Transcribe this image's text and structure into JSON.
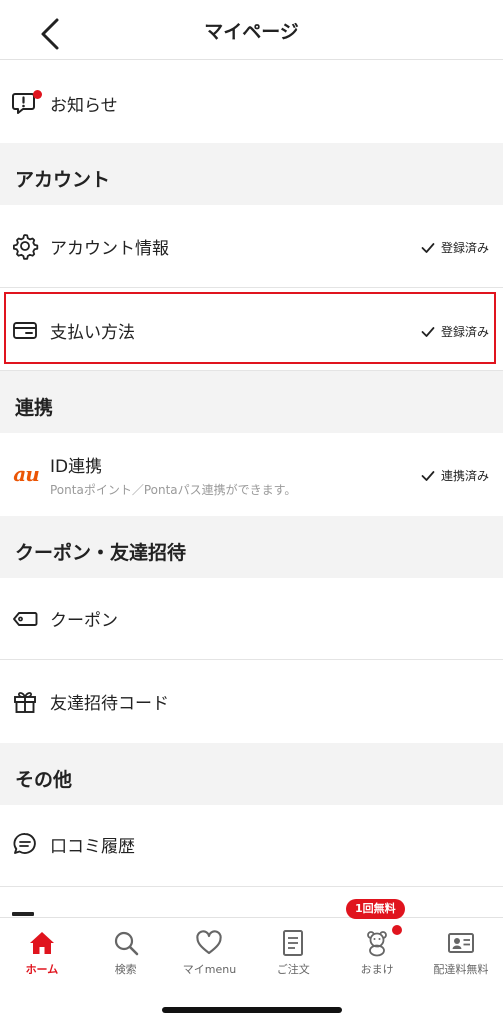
{
  "header": {
    "title": "マイページ"
  },
  "notice": {
    "label": "お知らせ"
  },
  "sections": {
    "account": "アカウント",
    "link": "連携",
    "coupon": "クーポン・友達招待",
    "other": "その他"
  },
  "account_info": {
    "label": "アカウント情報",
    "status": "登録済み"
  },
  "payment": {
    "label": "支払い方法",
    "status": "登録済み"
  },
  "id_link": {
    "logo": "au",
    "label": "ID連携",
    "sub": "Pontaポイント／Pontaパス連携ができます。",
    "status": "連携済み"
  },
  "coupon": {
    "label": "クーポン"
  },
  "invite": {
    "label": "友達招待コード"
  },
  "reviews": {
    "label": "口コミ履歴"
  },
  "tabbar": {
    "badge": "1回無料",
    "tabs": [
      {
        "label": "ホーム",
        "icon": "home-icon"
      },
      {
        "label": "検索",
        "icon": "search-icon"
      },
      {
        "label": "マイmenu",
        "icon": "heart-icon"
      },
      {
        "label": "ご注文",
        "icon": "order-icon"
      },
      {
        "label": "おまけ",
        "icon": "bear-icon"
      },
      {
        "label": "配達料無料",
        "icon": "member-card-icon"
      }
    ]
  },
  "colors": {
    "accent": "#e0141e",
    "section_bg": "#f3f3f3",
    "au_orange": "#eb5505"
  }
}
